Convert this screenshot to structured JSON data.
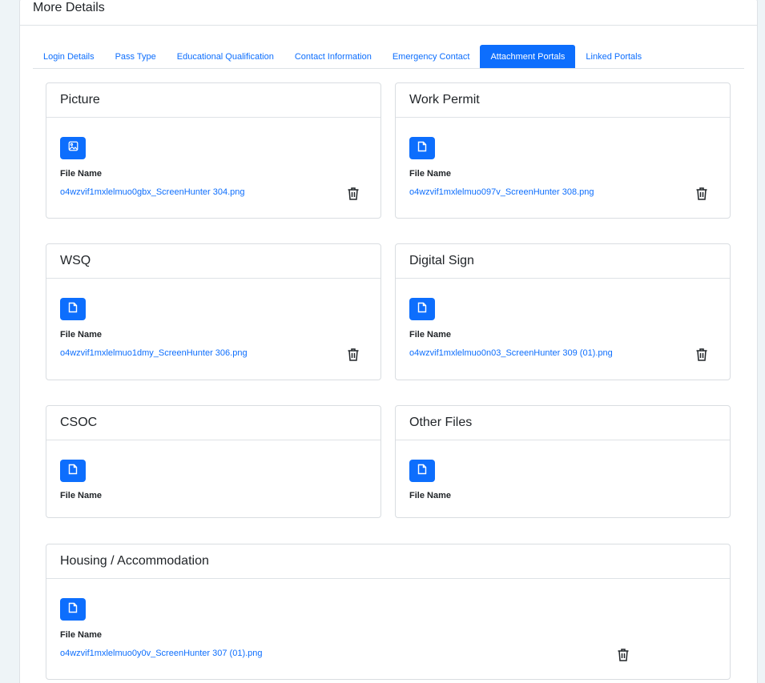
{
  "header": {
    "title": "More Details"
  },
  "tabs": [
    {
      "label": "Login Details"
    },
    {
      "label": "Pass Type"
    },
    {
      "label": "Educational Qualification"
    },
    {
      "label": "Contact Information"
    },
    {
      "label": "Emergency Contact"
    },
    {
      "label": "Attachment Portals",
      "active": true
    },
    {
      "label": "Linked Portals"
    }
  ],
  "attachments": {
    "picture": {
      "title": "Picture",
      "icon": "image-icon",
      "file_label": "File Name",
      "file_name": "o4wzvif1mxlelmuo0gbx_ScreenHunter 304.png"
    },
    "work_permit": {
      "title": "Work Permit",
      "icon": "file-icon",
      "file_label": "File Name",
      "file_name": "o4wzvif1mxlelmuo097v_ScreenHunter 308.png"
    },
    "wsq": {
      "title": "WSQ",
      "icon": "file-icon",
      "file_label": "File Name",
      "file_name": "o4wzvif1mxlelmuo1dmy_ScreenHunter 306.png"
    },
    "digital_sign": {
      "title": "Digital Sign",
      "icon": "file-icon",
      "file_label": "File Name",
      "file_name": "o4wzvif1mxlelmuo0n03_ScreenHunter 309 (01).png"
    },
    "csoc": {
      "title": "CSOC",
      "icon": "file-icon",
      "file_label": "File Name"
    },
    "other_files": {
      "title": "Other Files",
      "icon": "file-icon",
      "file_label": "File Name"
    },
    "housing": {
      "title": "Housing / Accommodation",
      "icon": "file-icon",
      "file_label": "File Name",
      "file_name": "o4wzvif1mxlelmuo0y0v_ScreenHunter 307 (01).png"
    }
  },
  "colors": {
    "accent": "#0d6efd",
    "border": "#dee2e6",
    "page_bg": "#eef4f7"
  }
}
